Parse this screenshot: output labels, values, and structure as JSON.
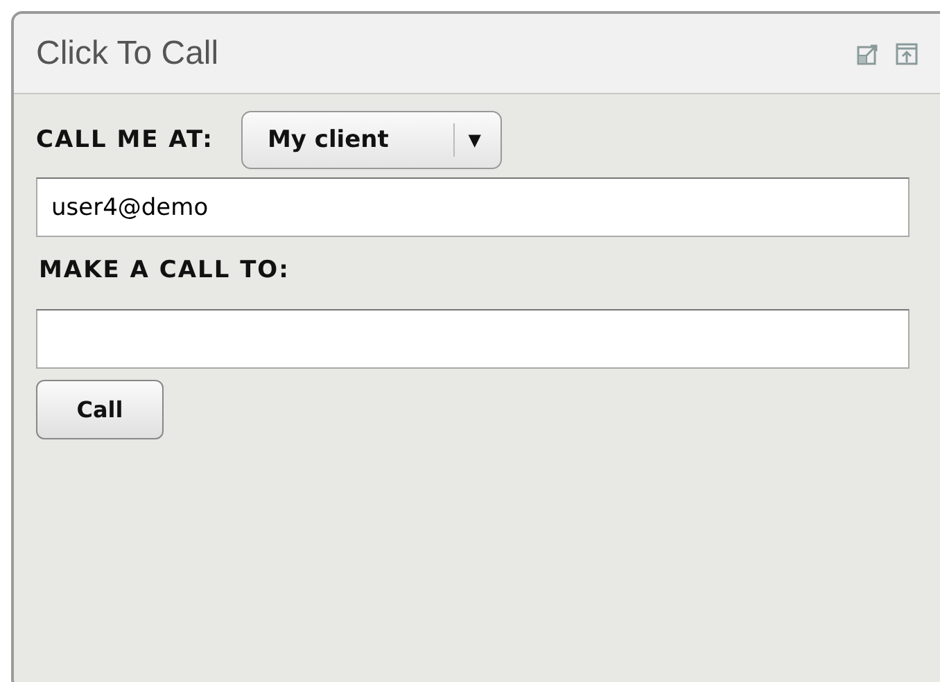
{
  "window": {
    "title": "Click To Call"
  },
  "call_me_at": {
    "label": "CALL ME AT:",
    "dropdown": {
      "value": "My client",
      "arrow": "▼"
    },
    "field": {
      "value": "user4@demo"
    }
  },
  "make_call_to": {
    "label": "MAKE A CALL TO:"
  },
  "buttons": [
    "Call"
  ]
}
